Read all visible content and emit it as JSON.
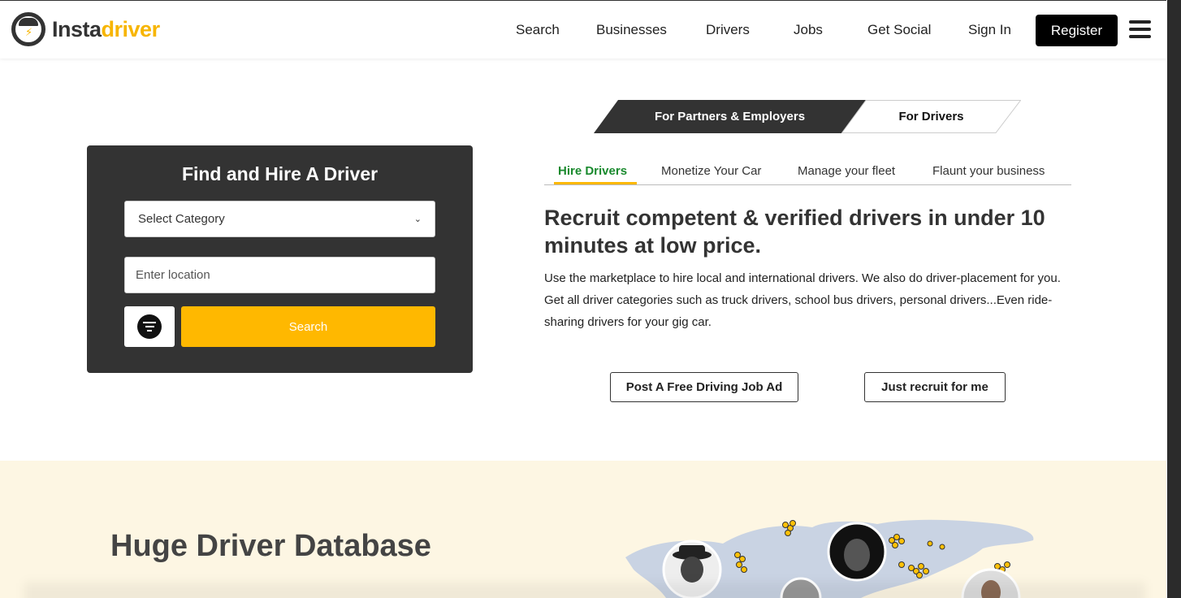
{
  "brand": {
    "name_part1": "Insta",
    "name_part2": "driver",
    "icon": "steering-wheel-icon",
    "accent": "#f7b500"
  },
  "nav": {
    "items": [
      "Search",
      "Businesses",
      "Drivers",
      "Jobs",
      "Get Social",
      "Sign In"
    ],
    "register_label": "Register",
    "menu_icon": "hamburger-icon"
  },
  "search_card": {
    "title": "Find and Hire A Driver",
    "category_value": "Select Category",
    "location_placeholder": "Enter location",
    "filter_icon": "filter-icon",
    "search_label": "Search"
  },
  "audience": {
    "partners_label": "For Partners & Employers",
    "drivers_label": "For Drivers"
  },
  "tabs": [
    "Hire Drivers",
    "Monetize Your Car",
    "Manage your fleet",
    "Flaunt your business"
  ],
  "hero": {
    "headline": "Recruit competent & verified drivers in under 10 minutes at low price.",
    "description": "Use the marketplace to hire local and international drivers. We also do driver-placement for you. Get all driver categories such as truck drivers, school bus drivers, personal drivers...Even ride-sharing drivers for your gig car.",
    "post_ad_label": "Post A Free Driving Job Ad",
    "recruit_label": "Just recruit for me"
  },
  "database": {
    "title": "Huge Driver Database"
  },
  "colors": {
    "primary_yellow": "#ffb800",
    "dark": "#333333",
    "active_tab": "#1a8a2e",
    "section_bg": "#fdf6e3"
  }
}
